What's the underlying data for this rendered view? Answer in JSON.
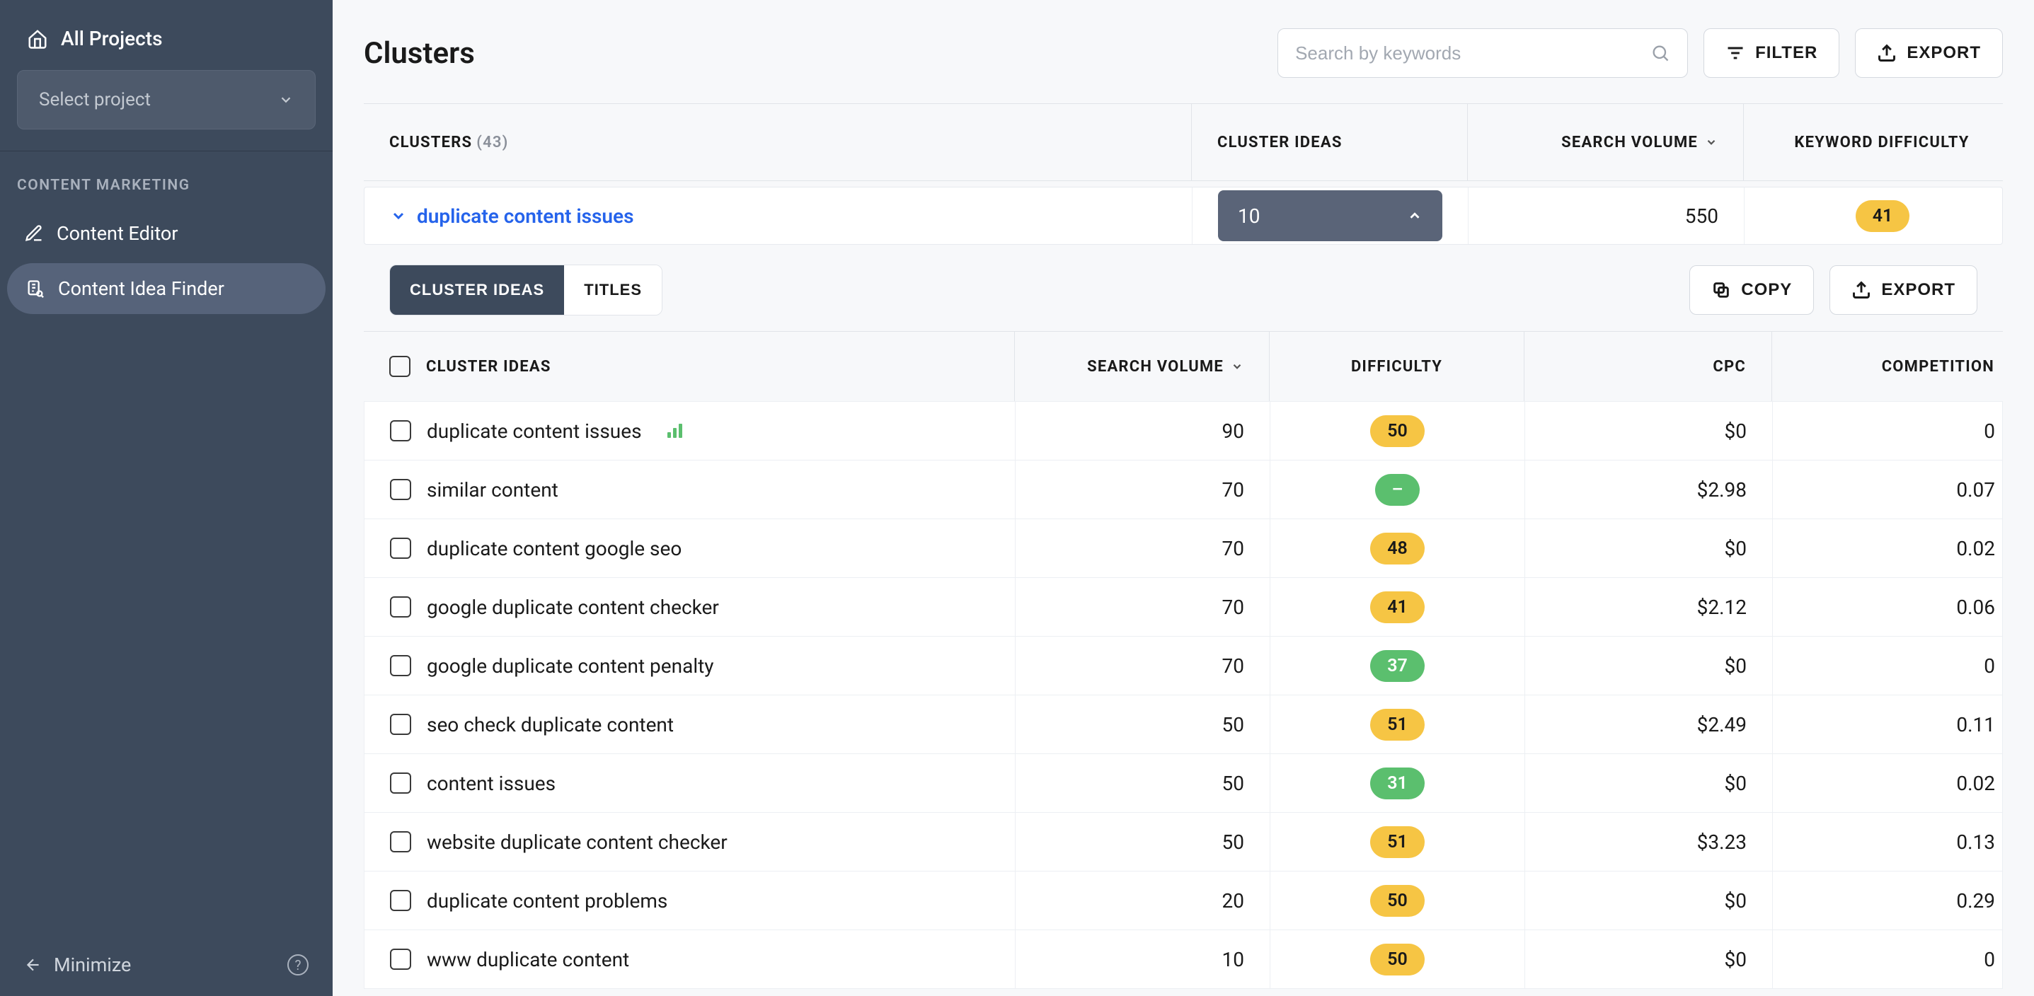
{
  "sidebar": {
    "all_projects": "All Projects",
    "project_select_placeholder": "Select project",
    "section_label": "CONTENT MARKETING",
    "nav": [
      {
        "label": "Content Editor"
      },
      {
        "label": "Content Idea Finder"
      }
    ],
    "minimize": "Minimize"
  },
  "page": {
    "title": "Clusters",
    "search_placeholder": "Search by keywords",
    "filter_btn": "FILTER",
    "export_btn": "EXPORT"
  },
  "cluster_header": {
    "clusters_label": "CLUSTERS",
    "clusters_count": "(43)",
    "ideas_label": "CLUSTER IDEAS",
    "sv_label": "SEARCH VOLUME",
    "kd_label": "KEYWORD DIFFICULTY"
  },
  "cluster_row": {
    "name": "duplicate content issues",
    "ideas": "10",
    "search_volume": "550",
    "kd": "41"
  },
  "midbar": {
    "tab_ideas": "CLUSTER IDEAS",
    "tab_titles": "TITLES",
    "copy": "COPY",
    "export": "EXPORT"
  },
  "idea_header": {
    "ideas": "CLUSTER IDEAS",
    "sv": "SEARCH VOLUME",
    "diff": "DIFFICULTY",
    "cpc": "CPC",
    "comp": "COMPETITION"
  },
  "ideas": [
    {
      "name": "duplicate content issues",
      "trend": true,
      "sv": "90",
      "diff": "50",
      "diff_color": "yellow",
      "cpc": "$0",
      "comp": "0"
    },
    {
      "name": "similar content",
      "trend": false,
      "sv": "70",
      "diff": "–",
      "diff_color": "green",
      "cpc": "$2.98",
      "comp": "0.07"
    },
    {
      "name": "duplicate content google seo",
      "trend": false,
      "sv": "70",
      "diff": "48",
      "diff_color": "yellow",
      "cpc": "$0",
      "comp": "0.02"
    },
    {
      "name": "google duplicate content checker",
      "trend": false,
      "sv": "70",
      "diff": "41",
      "diff_color": "yellow",
      "cpc": "$2.12",
      "comp": "0.06"
    },
    {
      "name": "google duplicate content penalty",
      "trend": false,
      "sv": "70",
      "diff": "37",
      "diff_color": "green",
      "cpc": "$0",
      "comp": "0"
    },
    {
      "name": "seo check duplicate content",
      "trend": false,
      "sv": "50",
      "diff": "51",
      "diff_color": "yellow",
      "cpc": "$2.49",
      "comp": "0.11"
    },
    {
      "name": "content issues",
      "trend": false,
      "sv": "50",
      "diff": "31",
      "diff_color": "green",
      "cpc": "$0",
      "comp": "0.02"
    },
    {
      "name": "website duplicate content checker",
      "trend": false,
      "sv": "50",
      "diff": "51",
      "diff_color": "yellow",
      "cpc": "$3.23",
      "comp": "0.13"
    },
    {
      "name": "duplicate content problems",
      "trend": false,
      "sv": "20",
      "diff": "50",
      "diff_color": "yellow",
      "cpc": "$0",
      "comp": "0.29"
    },
    {
      "name": "www duplicate content",
      "trend": false,
      "sv": "10",
      "diff": "50",
      "diff_color": "yellow",
      "cpc": "$0",
      "comp": "0"
    }
  ]
}
